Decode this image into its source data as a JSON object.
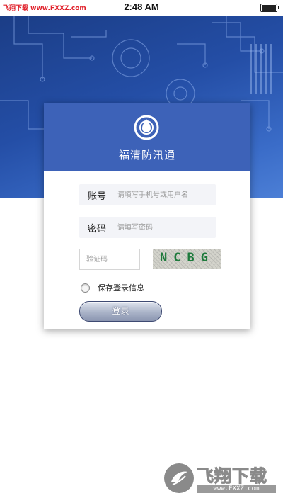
{
  "status_bar": {
    "watermark": "飞翔下载 www.FXXZ.com",
    "time": "2:48 AM"
  },
  "app": {
    "name": "福清防汛通",
    "logo_icon": "water-drop-icon"
  },
  "login_form": {
    "account_label": "账号",
    "account_placeholder": "请填写手机号或用户名",
    "account_value": "",
    "password_label": "密码",
    "password_placeholder": "请填写密码",
    "password_value": "",
    "captcha_placeholder": "验证码",
    "captcha_value": "",
    "captcha_code": "NCBG",
    "remember_label": "保存登录信息",
    "remember_checked": false,
    "login_button": "登录"
  },
  "watermark": {
    "title": "飞翔下载",
    "url": "www.FXXZ.com"
  },
  "colors": {
    "hero_blue": "#244ea6",
    "card_header": "#3d62b8",
    "captcha_text": "#1e7a3c",
    "watermark_red": "#e0202a"
  }
}
